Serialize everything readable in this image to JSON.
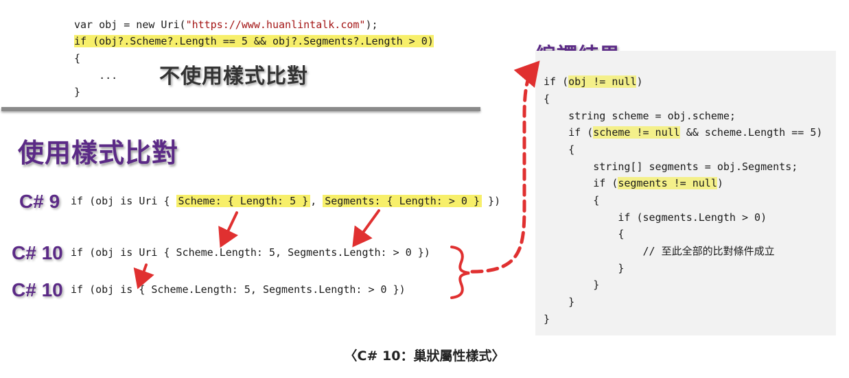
{
  "top_code": {
    "line1_pre": "var obj = new Uri(",
    "line1_str": "\"https://www.huanlintalk.com\"",
    "line1_post": ");",
    "line2": "if (obj?.Scheme?.Length == 5 && obj?.Segments?.Length > 0)",
    "line3": "{",
    "line4": "    ...",
    "line5": "}"
  },
  "note_no_pattern": "不使用樣式比對",
  "title_use_pattern": "使用樣式比對",
  "versions": {
    "v9": "C# 9",
    "v10a": "C# 10",
    "v10b": "C# 10"
  },
  "pattern_code": {
    "c9_pre": "if (obj is Uri { ",
    "c9_hl1": "Scheme: { Length: 5 }",
    "c9_mid": ", ",
    "c9_hl2": "Segments: { Length: > 0 }",
    "c9_post": " })",
    "c10a": "if (obj is Uri { Scheme.Length: 5, Segments.Length: > 0 })",
    "c10b": "if (obj is { Scheme.Length: 5, Segments.Length: > 0 })"
  },
  "result_title": "編譯結果",
  "compiled": {
    "l1_pre": "if (",
    "l1_hl": "obj != null",
    "l1_post": ")",
    "l2": "{",
    "l3": "    string scheme = obj.scheme;",
    "l4_pre": "    if (",
    "l4_hl": "scheme != null",
    "l4_post": " && scheme.Length == 5)",
    "l5": "    {",
    "l6": "        string[] segments = obj.Segments;",
    "l7_pre": "        if (",
    "l7_hl": "segments != null",
    "l7_post": ")",
    "l8": "        {",
    "l9": "            if (segments.Length > 0)",
    "l10": "            {",
    "l11": "                // 至此全部的比對條件成立",
    "l12": "            }",
    "l13": "        }",
    "l14": "    }",
    "l15": "}"
  },
  "caption": "〈C# 10：巢狀屬性樣式〉",
  "colors": {
    "highlight": "#f7ef6a",
    "purple": "#5b2a86",
    "arrow_red": "#e03030",
    "panel_bg": "#f2f2f2"
  }
}
